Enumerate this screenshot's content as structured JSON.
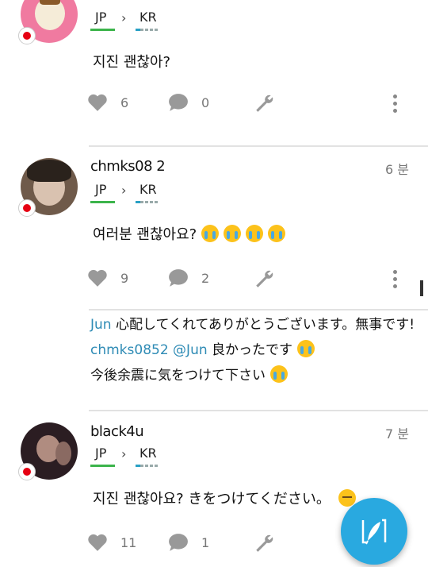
{
  "posts": [
    {
      "username": "",
      "time": "",
      "lang_from": "JP",
      "lang_to": "KR",
      "text": "지진 괜찮아?",
      "likes": "6",
      "comments": "0"
    },
    {
      "username": "chmks08 2",
      "time": "6 분",
      "lang_from": "JP",
      "lang_to": "KR",
      "text": "여러분 괜찮아요?",
      "likes": "9",
      "comments": "2"
    },
    {
      "username": "black4u",
      "time": "7 분",
      "lang_from": "JP",
      "lang_to": "KR",
      "text": "지진 괜찮아요? きをつけてください。",
      "likes": "11",
      "comments": "1"
    }
  ],
  "comment_thread": [
    {
      "user": "Jun",
      "text": " 心配してくれてありがとうございます。無事です!"
    },
    {
      "user": "chmks0852 @Jun",
      "text": " 良かったです"
    },
    {
      "user": "",
      "text": "今後余震に気をつけて下さい"
    }
  ],
  "icons": {
    "like": "heart-icon",
    "comment": "speech-bubble-icon",
    "correct": "wrench-icon",
    "more": "more-vertical-icon",
    "compose": "feather-pen-icon"
  },
  "colors": {
    "accent": "#29a9e0",
    "jp_underline": "#3cb44b",
    "username_link": "#2e8bb5"
  }
}
